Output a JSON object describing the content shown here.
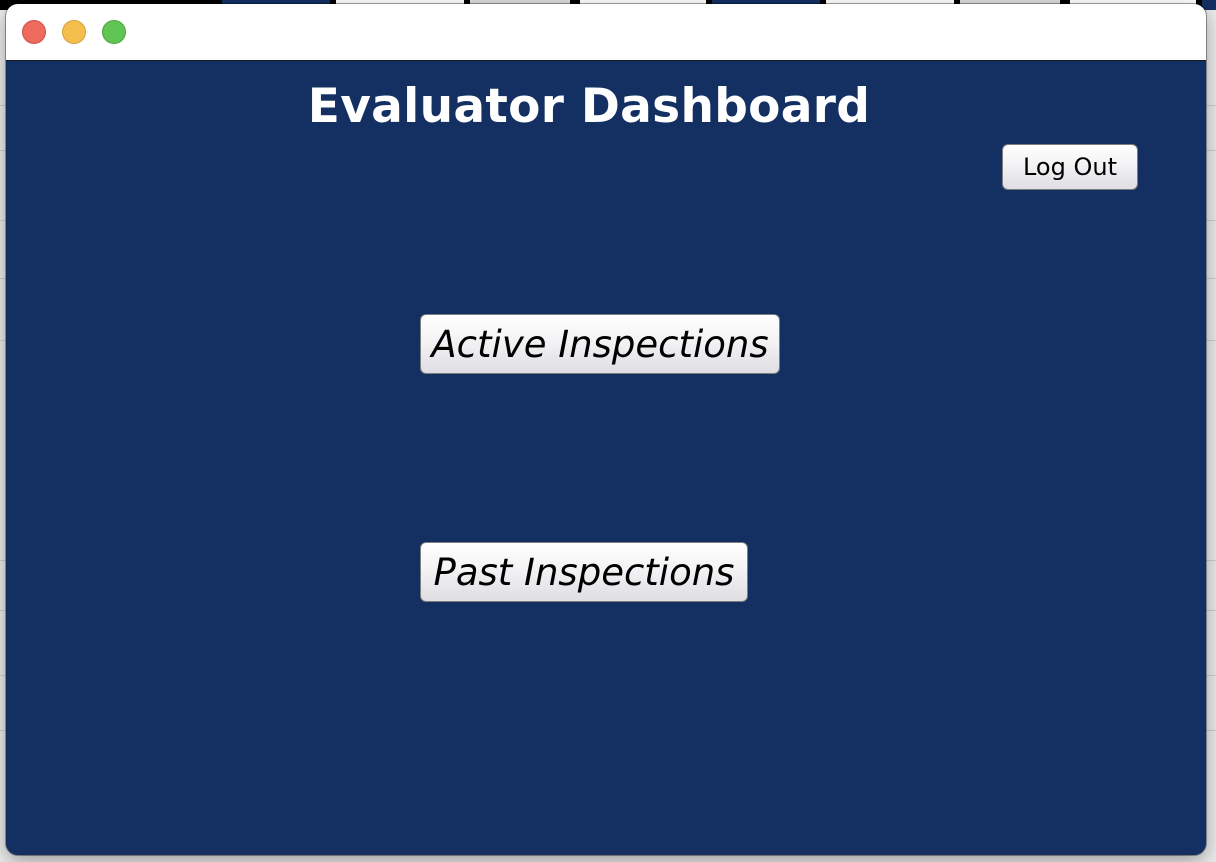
{
  "window": {
    "title": "Evaluator Dashboard"
  },
  "actions": {
    "logout_label": "Log Out",
    "active_label": "Active Inspections",
    "past_label": "Past Inspections"
  },
  "colors": {
    "background": "#143063",
    "title_text": "#ffffff"
  }
}
